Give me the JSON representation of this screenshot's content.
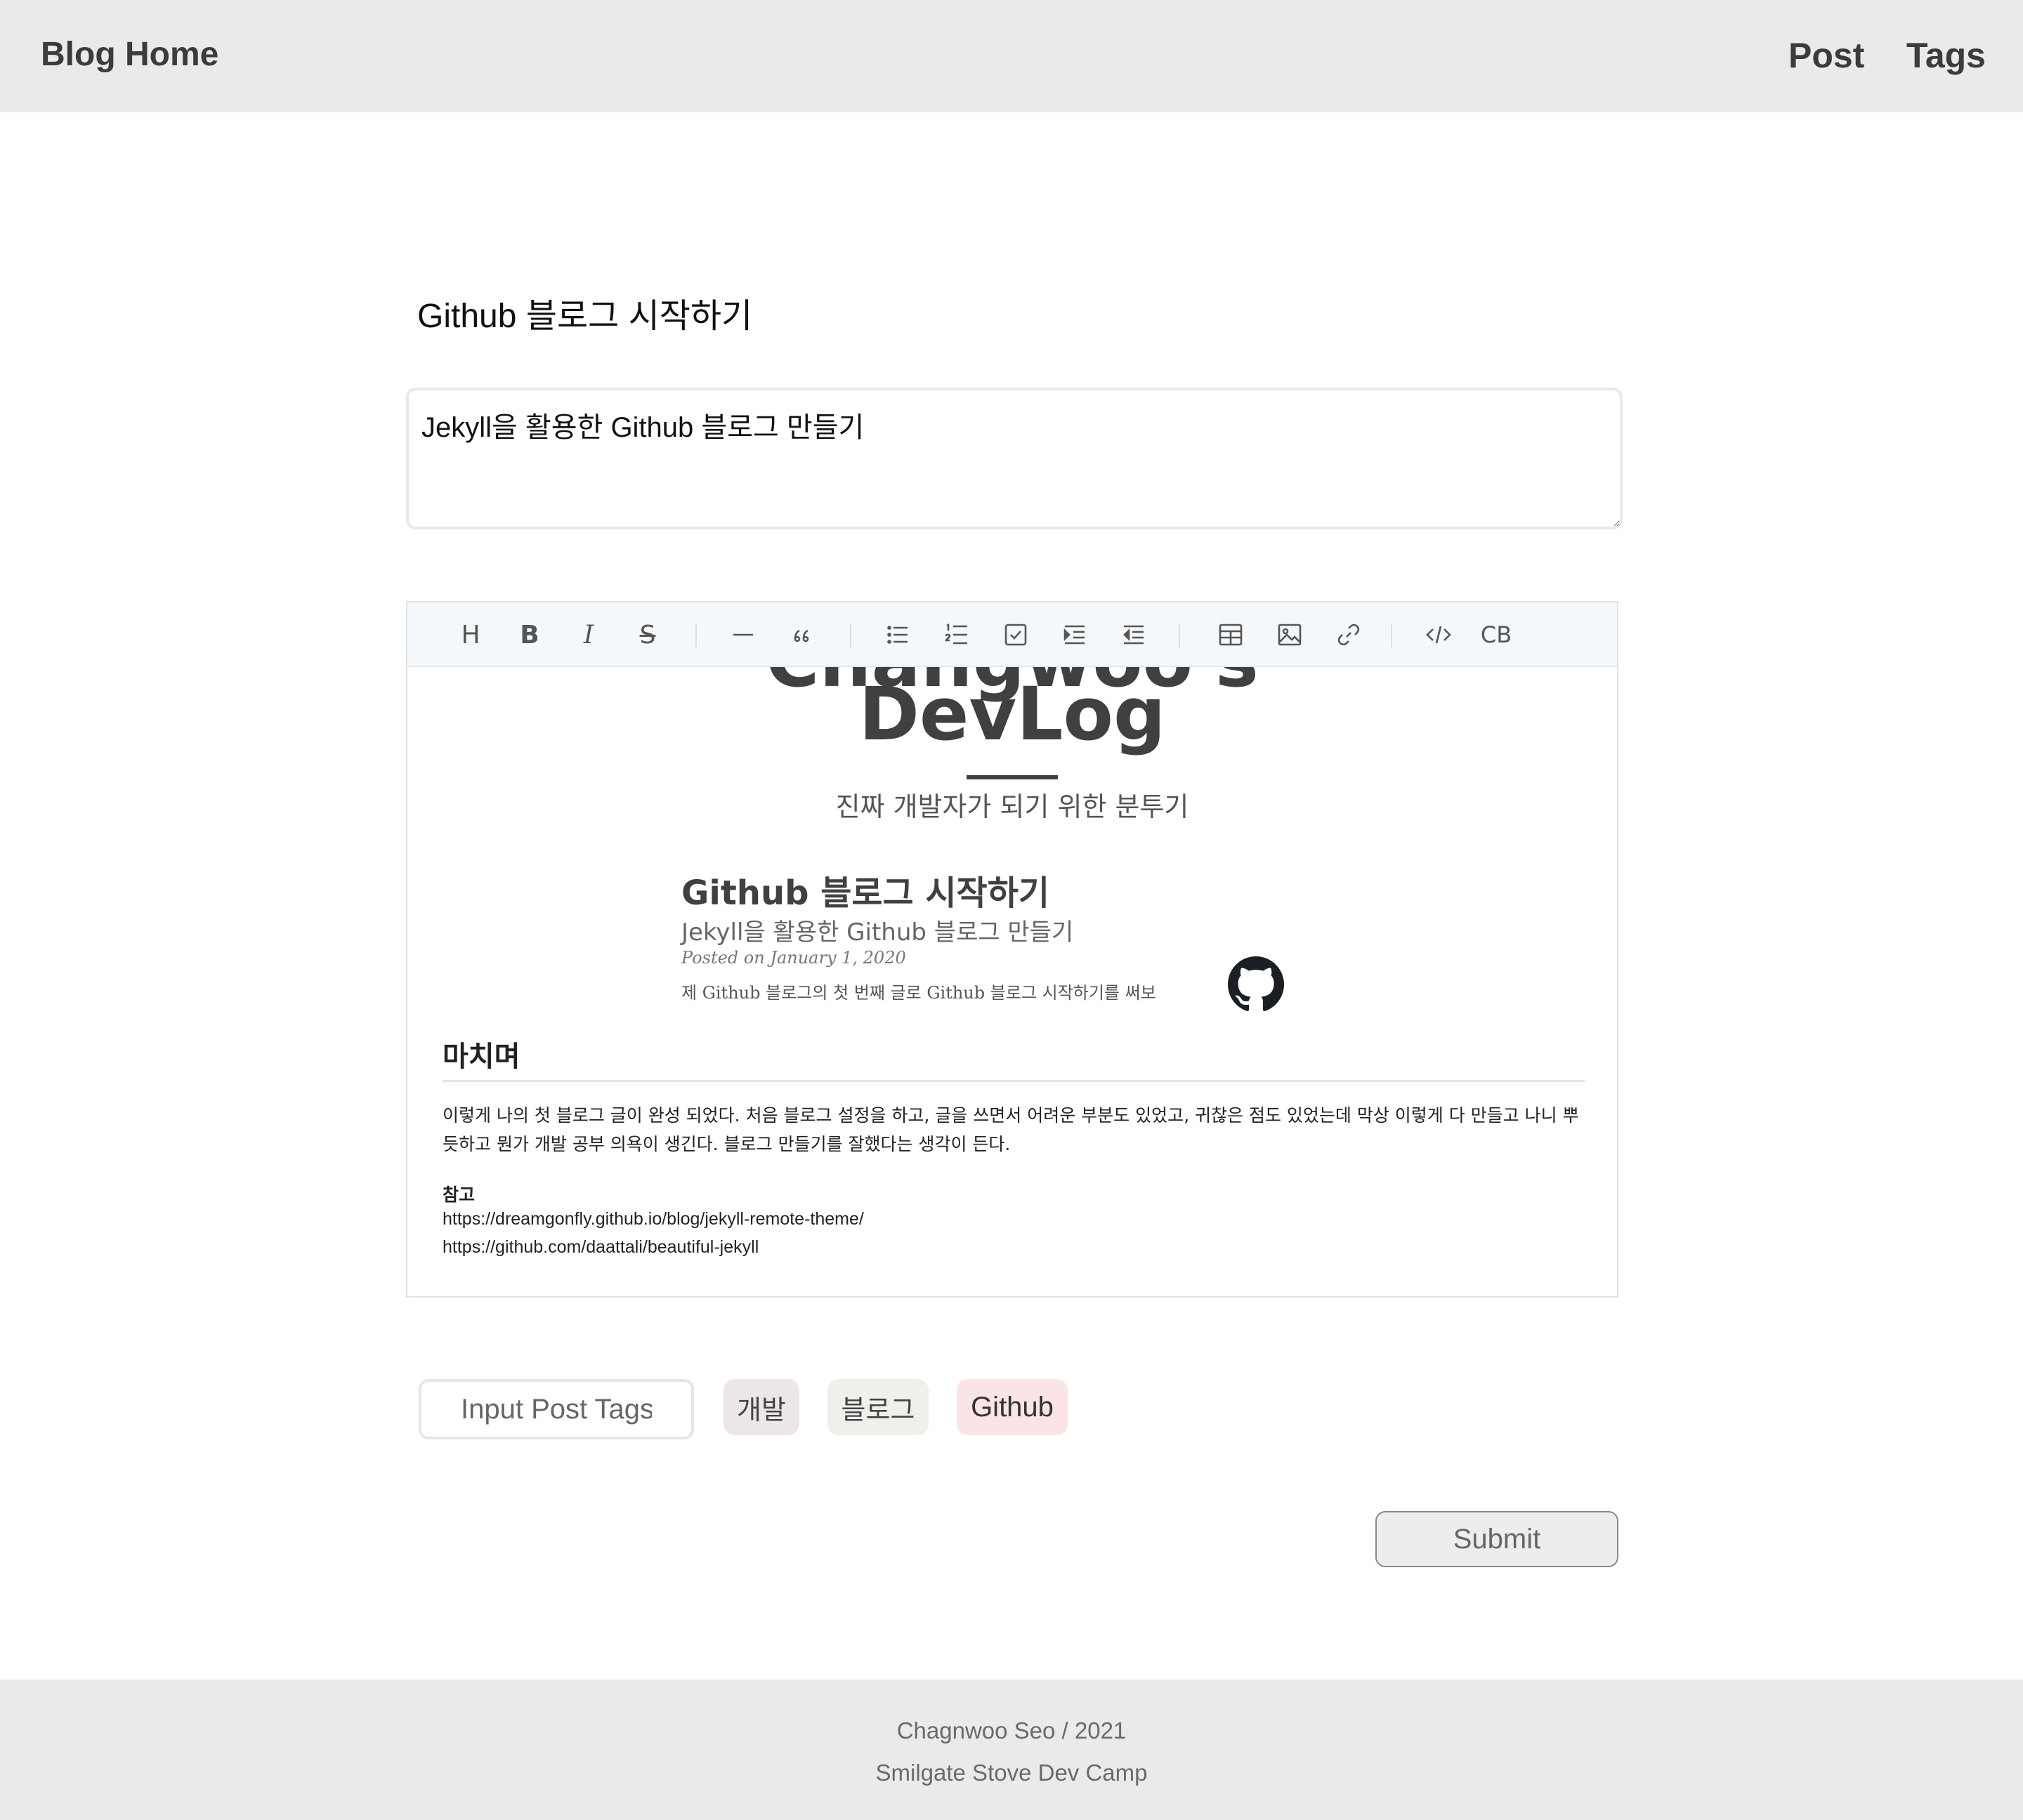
{
  "header": {
    "brand": "Blog Home",
    "nav": [
      {
        "label": "Post"
      },
      {
        "label": "Tags"
      }
    ]
  },
  "form": {
    "title_value": "Github 블로그 시작하기",
    "subtitle_value": "Jekyll을 활용한 Github 블로그 만들기"
  },
  "editor": {
    "toolbar": {
      "heading": "H",
      "bold": "B",
      "italic": "I",
      "strike": "S",
      "code_block": "CB"
    },
    "preview": {
      "hero_title_top": "Changwoo's",
      "hero_title": "DevLog",
      "hero_subtitle": "진짜 개발자가 되기 위한 분투기",
      "post_title": "Github 블로그 시작하기",
      "post_subtitle": "Jekyll을 활용한 Github 블로그 만들기",
      "post_meta": "Posted on January 1, 2020",
      "post_excerpt": "제 Github 블로그의 첫 번째 글로 Github 블로그 시작하기를 써보",
      "section_heading": "마치며",
      "paragraph": "이렇게 나의 첫 블로그 글이 완성 되었다. 처음 블로그 설정을 하고, 글을 쓰면서 어려운 부분도 있었고, 귀찮은 점도 있었는데 막상 이렇게 다 만들고 나니 뿌듯하고 뭔가 개발 공부 의욕이 생긴다. 블로그 만들기를 잘했다는 생각이 든다.",
      "ref_heading": "참고",
      "refs": [
        "https://dreamgonfly.github.io/blog/jekyll-remote-theme/",
        "https://github.com/daattali/beautiful-jekyll"
      ]
    }
  },
  "tags": {
    "input_placeholder": "Input Post Tags",
    "chips": [
      {
        "label": "개발",
        "color": "#ece6ea"
      },
      {
        "label": "블로그",
        "color": "#efefec"
      },
      {
        "label": "Github",
        "color": "#fbe4e6"
      }
    ]
  },
  "submit_label": "Submit",
  "footer": {
    "line1": "Chagnwoo Seo / 2021",
    "line2": "Smilgate Stove Dev Camp"
  },
  "colors": {
    "header_bg": "#eaeaea",
    "toolbar_bg": "#f5f8fb"
  }
}
